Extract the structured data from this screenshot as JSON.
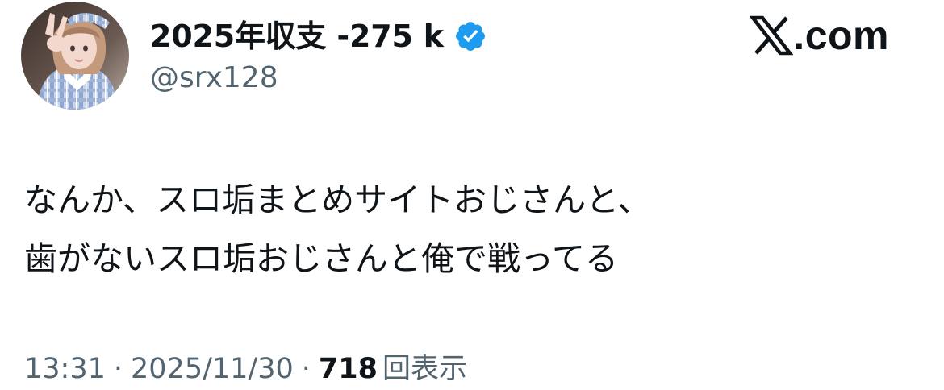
{
  "user": {
    "display_name": "2025年収支 -275 k",
    "handle": "@srx128",
    "verified": true,
    "avatar_icon": "profile-photo",
    "verified_color": "#1d9bf0"
  },
  "brand": {
    "text": ".com",
    "icon": "x-logo-icon"
  },
  "tweet": {
    "lines": [
      "なんか、スロ垢まとめサイトおじさんと、",
      "歯がないスロ垢おじさんと俺で戦ってる"
    ]
  },
  "meta": {
    "time": "13:31",
    "separator": "·",
    "date": "2025/11/30",
    "views_count": "718",
    "views_label": "回表示"
  },
  "colors": {
    "text_primary": "#0f1419",
    "text_secondary": "#536471",
    "background": "#ffffff"
  }
}
